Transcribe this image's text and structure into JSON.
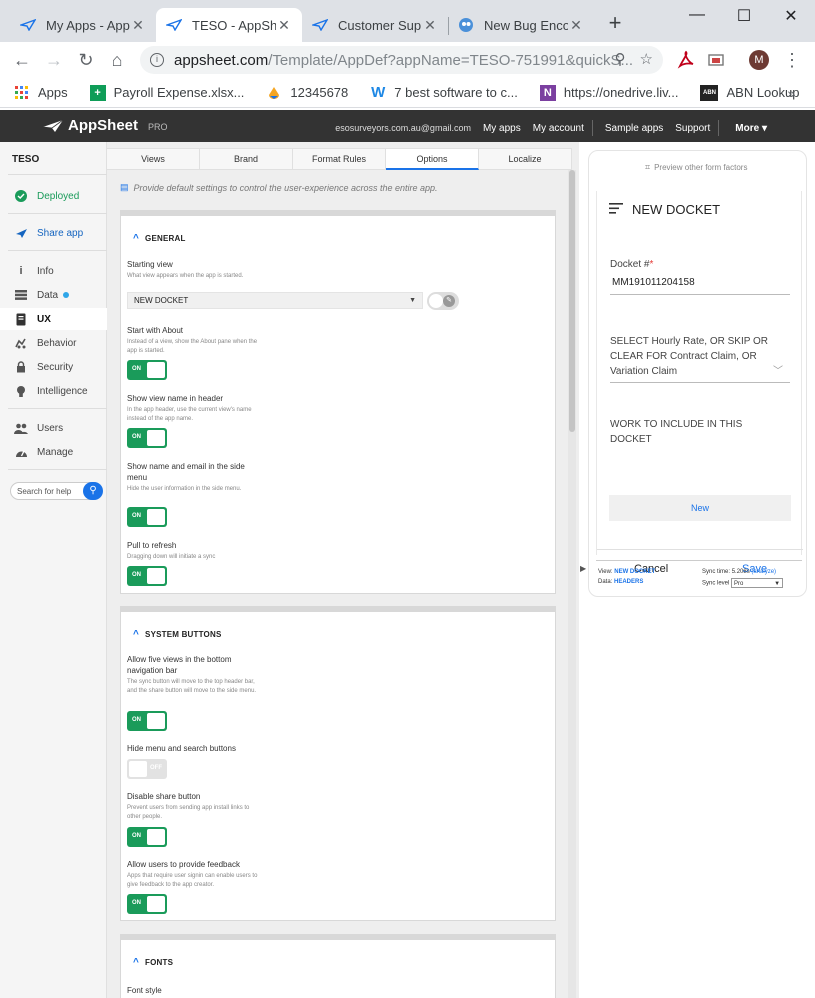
{
  "browser": {
    "tabs": [
      {
        "title": "My Apps - App"
      },
      {
        "title": "TESO - AppShee"
      },
      {
        "title": "Customer Supp"
      },
      {
        "title": "New Bug Enco"
      }
    ],
    "url_host": "appsheet.com",
    "url_path": "/Template/AppDef?appName=TESO-751991&quickS...",
    "avatar_letter": "M",
    "bookmarks": [
      {
        "label": "Apps"
      },
      {
        "label": "Payroll Expense.xlsx..."
      },
      {
        "label": "12345678"
      },
      {
        "label": "7 best software to c..."
      },
      {
        "label": "https://onedrive.liv..."
      },
      {
        "label": "ABN Lookup"
      }
    ]
  },
  "header": {
    "logo": "AppSheet",
    "pro": "PRO",
    "email": "esosurveyors.com.au@gmail.com",
    "my_apps": "My apps",
    "my_account": "My account",
    "sample_apps": "Sample apps",
    "support": "Support",
    "more": "More ▾"
  },
  "sidebar": {
    "app_name": "TESO",
    "deployed": "Deployed",
    "share": "Share app",
    "items": [
      {
        "label": "Info"
      },
      {
        "label": "Data"
      },
      {
        "label": "UX"
      },
      {
        "label": "Behavior"
      },
      {
        "label": "Security"
      },
      {
        "label": "Intelligence"
      },
      {
        "label": "Users"
      },
      {
        "label": "Manage"
      }
    ],
    "search_placeholder": "Search for help"
  },
  "main": {
    "subtabs": [
      {
        "label": "Views"
      },
      {
        "label": "Brand"
      },
      {
        "label": "Format Rules"
      },
      {
        "label": "Options"
      },
      {
        "label": "Localize"
      }
    ],
    "info_text": "Provide default settings to control the user-experience across the entire app.",
    "general": {
      "title": "GENERAL",
      "starting_view": {
        "label": "Starting view",
        "desc": "What view appears when the app is started.",
        "value": "NEW DOCKET"
      },
      "start_with_about": {
        "label": "Start with About",
        "desc": "Instead of a view, show the About pane when the app is started.",
        "state": "ON"
      },
      "show_view_name": {
        "label": "Show view name in header",
        "desc": "In the app header, use the current view's name instead of the app name.",
        "state": "ON"
      },
      "show_name_email": {
        "label": "Show name and email in the side menu",
        "desc": "Hide the user information in the side menu.",
        "state": "ON"
      },
      "pull_to_refresh": {
        "label": "Pull to refresh",
        "desc": "Dragging down will initiate a sync",
        "state": "ON"
      }
    },
    "system_buttons": {
      "title": "SYSTEM BUTTONS",
      "five_views": {
        "label": "Allow five views in the bottom navigation bar",
        "desc": "The sync button will move to the top header bar, and the share button will move to the side menu.",
        "state": "ON"
      },
      "hide_menu": {
        "label": "Hide menu and search buttons",
        "state": "OFF"
      },
      "disable_share": {
        "label": "Disable share button",
        "desc": "Prevent users from sending app install links to other people.",
        "state": "ON"
      },
      "feedback": {
        "label": "Allow users to provide feedback",
        "desc": "Apps that require user signin can enable users to give feedback to the app creator.",
        "state": "ON"
      }
    },
    "fonts": {
      "title": "FONTS",
      "font_style_label": "Font style"
    }
  },
  "preview": {
    "other_factors": "Preview other form factors",
    "view_title": "NEW DOCKET",
    "docket_label": "Docket #",
    "docket_required": "*",
    "docket_value": "MM191011204158",
    "select_label": "SELECT Hourly Rate, OR SKIP OR CLEAR FOR Contract Claim, OR Variation Claim",
    "work_label": "WORK TO INCLUDE IN THIS DOCKET",
    "new_button": "New",
    "cancel": "Cancel",
    "save": "Save",
    "footer": {
      "view_label": "View:",
      "view_value": "NEW DOCKET",
      "data_label": "Data:",
      "data_value": "HEADERS",
      "sync_time_label": "Sync time:",
      "sync_time_value": "5.208s",
      "analyze": "(analyze)",
      "sync_level_label": "Sync level",
      "sync_level_value": "Pro"
    }
  },
  "colors": {
    "accent": "#1a73e8",
    "toggle_on": "#1a9b5a",
    "header_bg": "#333333"
  }
}
